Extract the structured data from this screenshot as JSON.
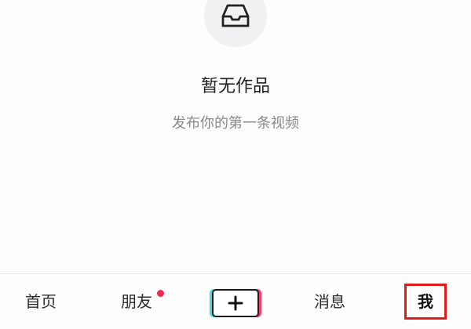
{
  "empty_state": {
    "icon": "inbox-icon",
    "title": "暂无作品",
    "subtitle": "发布你的第一条视频"
  },
  "tabbar": {
    "home_label": "首页",
    "friends_label": "朋友",
    "friends_has_notification": true,
    "create_icon": "plus-icon",
    "messages_label": "消息",
    "me_label": "我",
    "active_tab": "me"
  },
  "colors": {
    "background": "#fdfcff",
    "notification_dot": "#f2284e",
    "highlight_border": "#e21a1a",
    "create_accent_left": "#35e0e8",
    "create_accent_right": "#ff3b6b"
  }
}
